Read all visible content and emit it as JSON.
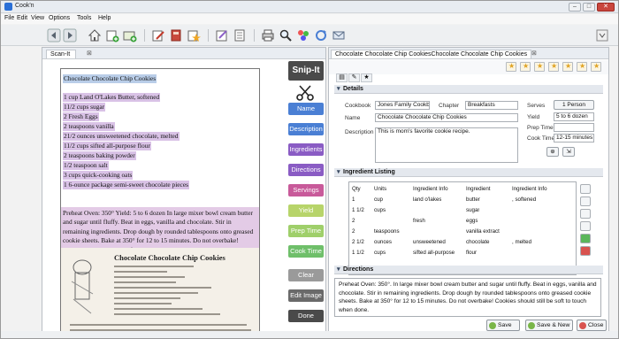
{
  "window": {
    "title": "Cook'n",
    "min": "–",
    "max": "□",
    "close": "✕"
  },
  "menu": [
    "File",
    "Edit",
    "View",
    "Options",
    "Tools",
    "Help"
  ],
  "left_tab": {
    "label": "Scan-It",
    "close": "⊠"
  },
  "document": {
    "title": "Chocolate Chocolate Chip Cookies",
    "ingredients": [
      "1 cup Land O'Lakes Butter, softened",
      "11/2 cups sugar",
      "2 Fresh Eggs",
      "2 teaspoons vanilla",
      "21/2 ounces unsweetened chocolate, melted",
      "11/2 cups sifted all-purpose flour",
      "2 teaspoons baking powder",
      "1/2 teaspoon salt",
      "3 cups quick-cooking oats",
      "1 6-ounce package semi-sweet chocolate pieces"
    ],
    "directions": "Preheat Oven: 350° Yield: 5 to 6 dozen In large mixer bowl cream butter and sugar until fluffy. Beat in eggs, vanilla and chocolate. Stir in remaining ingredients. Drop dough by rounded tablespoons onto greased cookie sheets. Bake at 350° for 12 to 15 minutes. Do not overbake! Cookies should still be soft to touch when done.",
    "scan_title": "Chocolate Chocolate Chip Cookies"
  },
  "snip": {
    "header": "Snip-It",
    "buttons": [
      {
        "label": "Name",
        "color": "#4a7fd4"
      },
      {
        "label": "Description",
        "color": "#4a7fd4"
      },
      {
        "label": "Ingredients",
        "color": "#8a5cc4"
      },
      {
        "label": "Directions",
        "color": "#8a5cc4"
      },
      {
        "label": "Servings",
        "color": "#c85a9a"
      },
      {
        "label": "Yield",
        "color": "#b7d46a"
      },
      {
        "label": "Prep Time",
        "color": "#9fcf6a"
      },
      {
        "label": "Cook Time",
        "color": "#6fbf6a"
      },
      {
        "label": "Clear",
        "color": "#9a9a9a"
      },
      {
        "label": "Edit Image",
        "color": "#6a6a6a"
      },
      {
        "label": "Done",
        "color": "#4a4a4a"
      }
    ]
  },
  "right_tab": {
    "label": "Chocolate Chocolate Chip CookiesChocolate Chocolate Chip Cookies",
    "close": "⊠"
  },
  "details": {
    "section": "Details",
    "cookbook_label": "Cookbook",
    "cookbook": "Jones Family Cookbo",
    "chapter_label": "Chapter",
    "chapter": "Breakfasts",
    "name_label": "Name",
    "name": "Chocolate Chocolate Chip Cookies",
    "description_label": "Description",
    "description": "This is mom's favorite cookie recipe.",
    "serves_label": "Serves",
    "serves": "1 Person",
    "yield_label": "Yield",
    "yield": "5 to 6 dozen",
    "prep_label": "Prep Time",
    "prep": "",
    "cook_label": "Cook Time",
    "cook": "12-15 minutes"
  },
  "ingredients_section": {
    "section": "Ingredient Listing",
    "headers": [
      "Qty",
      "Units",
      "Ingredient Info",
      "Ingredient",
      "Ingredient Info"
    ],
    "rows": [
      [
        "1",
        "cup",
        "land o'lakes",
        "butter",
        ", softened"
      ],
      [
        "1 1/2",
        "cups",
        "",
        "sugar",
        ""
      ],
      [
        "2",
        "",
        "fresh",
        "eggs",
        ""
      ],
      [
        "2",
        "teaspoons",
        "",
        "vanilla extract",
        ""
      ],
      [
        "2 1/2",
        "ounces",
        "unsweetened",
        "chocolate",
        ", melted"
      ],
      [
        "1 1/2",
        "cups",
        "sifted all-purpose",
        "flour",
        ""
      ]
    ]
  },
  "directions_section": {
    "section": "Directions",
    "text": "Preheat Oven: 350°. In large mixer bowl cream butter and sugar until fluffy. Beat in eggs, vanilla and chocolate. Stir in remaining ingredients. Drop dough by rounded tablespoons onto greased cookie sheets. Bake at 350° for 12 to 15 minutes. Do not overbake! Cookies should still be soft to touch when done."
  },
  "footer": {
    "save": "Save",
    "save_new": "Save & New",
    "close": "Close"
  }
}
